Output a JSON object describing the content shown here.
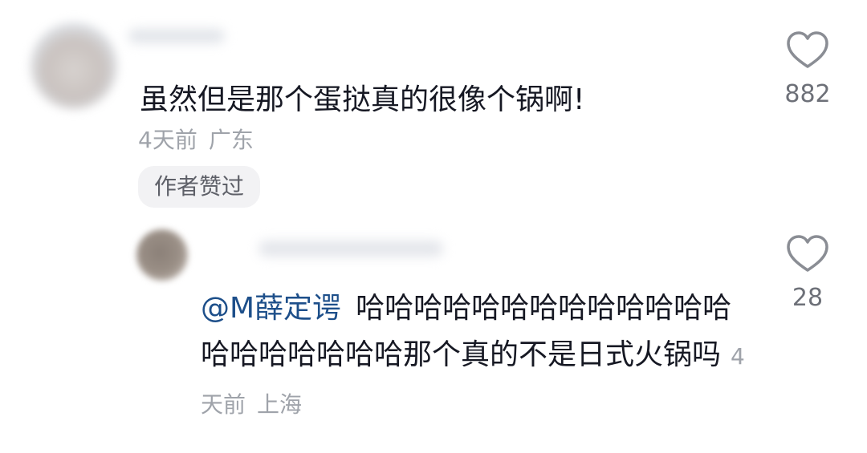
{
  "comment": {
    "text": "虽然但是那个蛋挞真的很像个锅啊!",
    "time": "4天前",
    "location": "广东",
    "badge": "作者赞过",
    "like_count": "882",
    "like_icon": "heart-outline-icon"
  },
  "reply": {
    "mention": "@M薛定谔",
    "text": "哈哈哈哈哈哈哈哈哈哈哈哈哈哈哈哈哈哈哈哈那个真的不是日式火锅吗",
    "time": "4天前",
    "location": "上海",
    "like_count": "28",
    "like_icon": "heart-outline-icon"
  },
  "colors": {
    "text": "#161823",
    "meta": "#9fa3aa",
    "mention": "#1d4f8a",
    "badge_bg": "#f2f2f4"
  }
}
